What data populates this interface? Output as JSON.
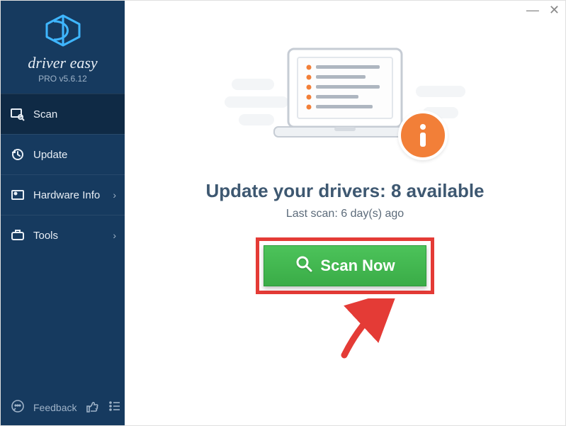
{
  "app": {
    "name": "driver easy",
    "version": "PRO v5.6.12"
  },
  "nav": {
    "scan": "Scan",
    "update": "Update",
    "hardware": "Hardware Info",
    "tools": "Tools"
  },
  "footer": {
    "feedback": "Feedback"
  },
  "main": {
    "headline": "Update your drivers: 8 available",
    "subline": "Last scan: 6 day(s) ago",
    "scan_button": "Scan Now"
  }
}
